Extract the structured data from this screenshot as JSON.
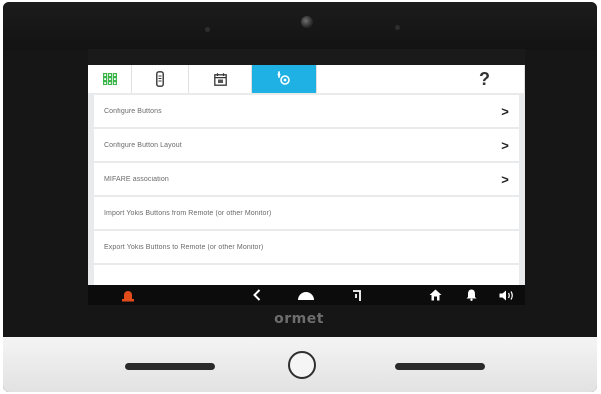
{
  "device": {
    "brand": "ormet"
  },
  "tabs": [
    {
      "icon": "grid-icon",
      "active": false
    },
    {
      "icon": "handset-icon",
      "active": false
    },
    {
      "icon": "calendar-icon",
      "active": false
    },
    {
      "icon": "settings-touch-icon",
      "active": true
    }
  ],
  "help_label": "?",
  "menu": {
    "items": [
      {
        "label": "Configure Buttons",
        "has_arrow": true
      },
      {
        "label": "Configure Button Layout",
        "has_arrow": true
      },
      {
        "label": "MIFARE association",
        "has_arrow": true
      },
      {
        "label": "Import Yokis Buttons from Remote (or other Monitor)",
        "has_arrow": false
      },
      {
        "label": "Export Yokis Buttons to Remote (or other Monitor)",
        "has_arrow": false
      }
    ],
    "arrow_glyph": ">"
  },
  "navbar": {
    "icons": [
      "alarm-icon",
      "back-icon",
      "home-icon",
      "door-opener-icon",
      "house-icon",
      "bell-icon",
      "volume-icon"
    ]
  },
  "colors": {
    "accent": "#1fb1e3",
    "alarm": "#e24b1a",
    "grid_green": "#3bb54a"
  }
}
